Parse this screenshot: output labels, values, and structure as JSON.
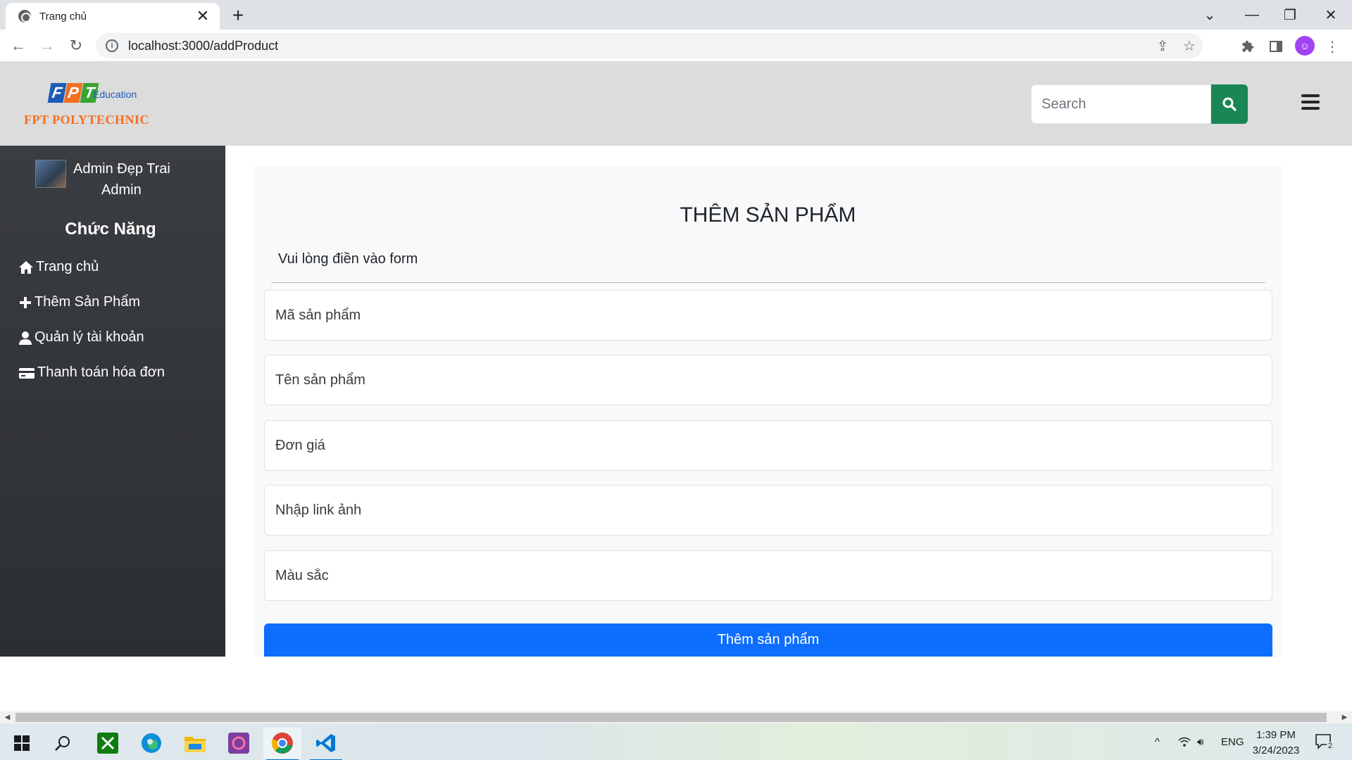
{
  "browser": {
    "tab_title": "Trang chủ",
    "url": "localhost:3000/addProduct",
    "tab_close": "✕",
    "new_tab": "+"
  },
  "header": {
    "logo_letters": [
      "F",
      "P",
      "T"
    ],
    "logo_edu": "Education",
    "logo_poly": "FPT POLYTECHNIC",
    "search_placeholder": "Search"
  },
  "sidebar": {
    "user_name": "Admin Đẹp Trai",
    "user_role": "Admin",
    "section_title": "Chức Năng",
    "items": [
      {
        "label": "Trang chủ",
        "icon": "home-icon"
      },
      {
        "label": "Thêm Sản Phẩm",
        "icon": "plus-icon"
      },
      {
        "label": "Quản lý tài khoản",
        "icon": "user-icon"
      },
      {
        "label": "Thanh toán hóa đơn",
        "icon": "credit-card-icon"
      }
    ]
  },
  "form": {
    "title": "THÊM SẢN PHẨM",
    "subtitle": "Vui lòng điền vào form",
    "fields": [
      {
        "placeholder": "Mã sản phẩm"
      },
      {
        "placeholder": "Tên sản phẩm"
      },
      {
        "placeholder": "Đơn giá"
      },
      {
        "placeholder": "Nhập link ảnh"
      },
      {
        "placeholder": "Màu sắc"
      }
    ],
    "submit_label": "Thêm sản phẩm"
  },
  "taskbar": {
    "lang": "ENG",
    "time": "1:39 PM",
    "date": "3/24/2023",
    "notifications": "2"
  },
  "colors": {
    "header_bg": "#dcdcdc",
    "sidebar_bg": "#343a40",
    "search_button": "#198754",
    "primary_button": "#0d6efd"
  }
}
